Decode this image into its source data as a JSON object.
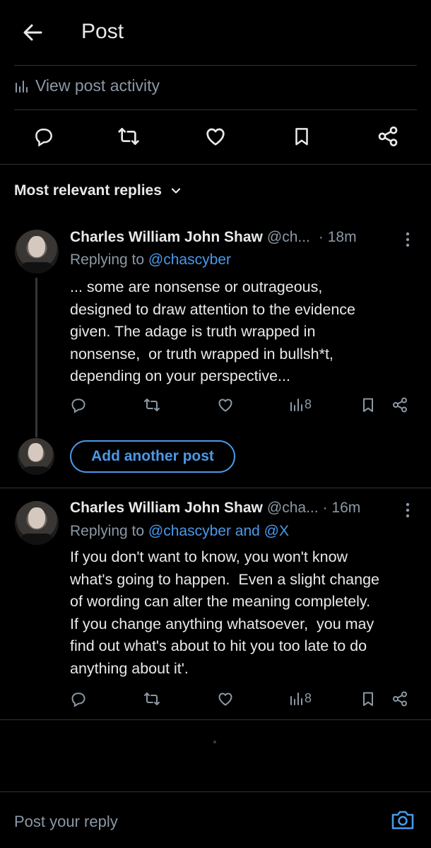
{
  "header": {
    "title": "Post"
  },
  "activity": {
    "label": "View post activity"
  },
  "sort": {
    "label": "Most relevant replies"
  },
  "replies": [
    {
      "name": "Charles William John Shaw",
      "handle": "@ch...",
      "time": "· 18m",
      "replying_prefix": "Replying to",
      "replying_to": "@chascyber",
      "text": "... some are nonsense or outrageous,\ndesigned to draw attention to the evidence\ngiven. The adage is truth wrapped in\nnonsense,  or truth wrapped in bullsh*t,\ndepending on your perspective...",
      "views": "8"
    },
    {
      "name": "Charles William John Shaw",
      "handle": "@cha...",
      "time": "· 16m",
      "replying_prefix": "Replying to",
      "replying_to": "@chascyber and @X",
      "text": "If you don't want to know, you won't know\nwhat's going to happen.  Even a slight change\nof wording can alter the meaning completely.\nIf you change anything whatsoever,  you may\nfind out what's about to hit you too late to do\nanything about it'.",
      "views": "8"
    }
  ],
  "add_post": {
    "label": "Add another post"
  },
  "composer": {
    "placeholder": "Post your reply"
  },
  "colors": {
    "accent": "#4a99e9",
    "background": "#000000",
    "muted": "#8b98a5",
    "text": "#e7e9ea",
    "divider": "#2f3336"
  },
  "icons": [
    "back-arrow-icon",
    "bar-chart-icon",
    "reply-icon",
    "repost-icon",
    "like-icon",
    "bookmark-icon",
    "share-icon",
    "chevron-down-icon",
    "more-vertical-icon",
    "camera-icon"
  ]
}
